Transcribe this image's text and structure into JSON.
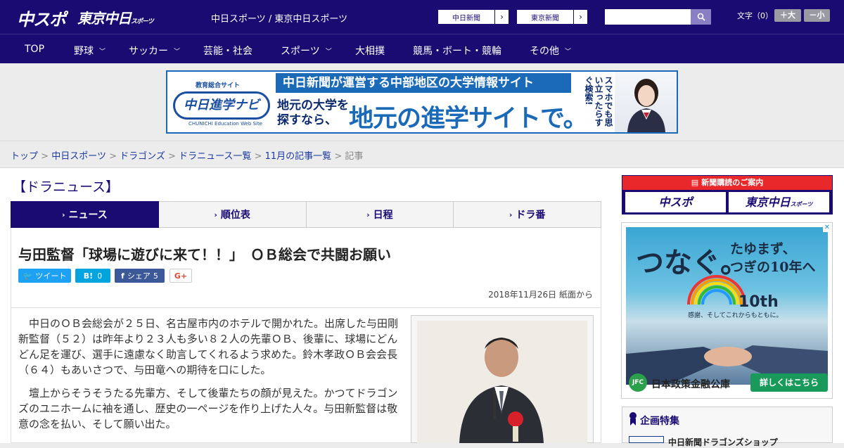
{
  "header": {
    "logo_main": "中スポ",
    "logo_tokyo": "東京中日",
    "logo_tokyo_suffix": "スポーツ",
    "site_names": "中日スポーツ / 東京中日スポーツ",
    "link_chunichi": "中日新聞",
    "link_tokyo": "東京新聞",
    "search_placeholder": "",
    "font_size_label": "文字（0）",
    "font_up": "＋大",
    "font_down": "－小"
  },
  "nav": {
    "items": [
      {
        "label": "TOP",
        "has_menu": false
      },
      {
        "label": "野球",
        "has_menu": true
      },
      {
        "label": "サッカー",
        "has_menu": true
      },
      {
        "label": "芸能・社会",
        "has_menu": false
      },
      {
        "label": "スポーツ",
        "has_menu": true
      },
      {
        "label": "大相撲",
        "has_menu": false
      },
      {
        "label": "競馬・ボート・競輪",
        "has_menu": false
      },
      {
        "label": "その他",
        "has_menu": true
      }
    ]
  },
  "banner": {
    "logo_top": "教育総合サイト",
    "logo_main": "中日進学ナビ",
    "logo_sub": "CHUNICHI Education Web Site",
    "headline": "中日新聞が運営する中部地区の大学情報サイト",
    "small_text": "地元の大学を\n探すなら、",
    "big_text": "地元の進学サイトで。",
    "vertical_text": "スマホでも思い立ったらすぐ検索!"
  },
  "breadcrumb": {
    "items": [
      "トップ",
      "中日スポーツ",
      "ドラゴンズ",
      "ドラニュース一覧",
      "11月の記事一覧"
    ],
    "current": "記事",
    "separator": ">"
  },
  "section_title": "【ドラニュース】",
  "tabs": [
    {
      "label": "ニュース",
      "active": true
    },
    {
      "label": "順位表",
      "active": false
    },
    {
      "label": "日程",
      "active": false
    },
    {
      "label": "ドラ番",
      "active": false
    }
  ],
  "article": {
    "title": "与田監督「球場に遊びに来て！！」　ＯＢ総会で共闘お願い",
    "share": {
      "tweet": "ツイート",
      "hatena_count": "0",
      "facebook": "シェア",
      "facebook_count": "5",
      "gplus": "G+"
    },
    "date": "2018年11月26日 紙面から",
    "paragraphs": [
      "中日のＯＢ会総会が２５日、名古屋市内のホテルで開かれた。出席した与田剛新監督（５２）は昨年より２３人も多い８２人の先輩ＯＢ、後輩に、球場にどんどん足を運び、選手に遠慮なく助言してくれるよう求めた。鈴木孝政ＯＢ会会長（６４）もあいさつで、与田竜への期待を口にした。",
      "壇上からそうそうたる先輩方、そして後輩たちの顔が見えた。かつてドラゴンズのユニホームに袖を通し、歴史の一ページを作り上げた人々。与田新監督は敬意の念を払い、そして願い出た。"
    ]
  },
  "sidebar": {
    "subscribe_head": "新聞購読のご案内",
    "subscribe_chuspo": "中スポ",
    "subscribe_tokyo": "東京中日",
    "subscribe_tokyo_suffix": "スポーツ",
    "ad": {
      "line1": "つなぐ。",
      "line2": "たゆまず、",
      "line3": "つぎの10年へ",
      "anniv": "10th",
      "anniv_sub": "感謝、そしてこれからもともに。",
      "company": "日本政策金融公庫",
      "company_badge": "JFC",
      "cta": "詳しくはこちら",
      "close": "✕"
    },
    "feature_title": "企画特集",
    "feature_item": "中日新聞ドラゴンズショップ"
  },
  "colors": {
    "brand_navy": "#1a0b73",
    "accent_red": "#e8282b",
    "twitter": "#1da1f2",
    "hatena": "#00a4de",
    "facebook": "#3b5998",
    "link": "#1a3aa0"
  }
}
